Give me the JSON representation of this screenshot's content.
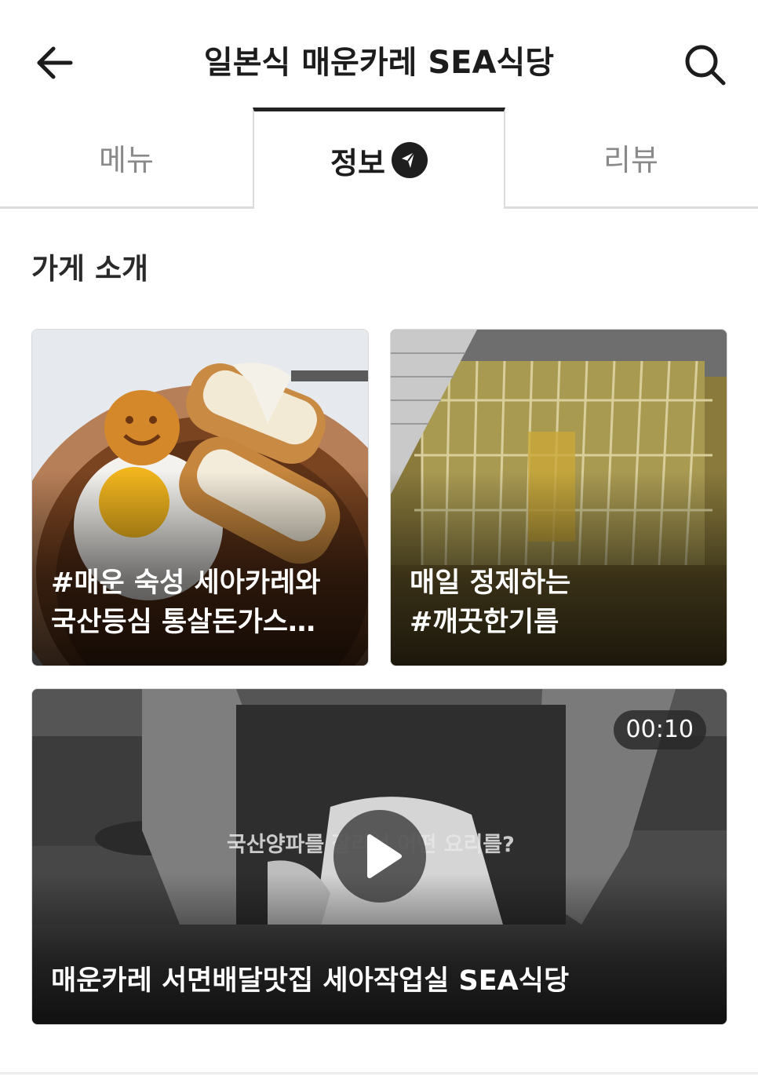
{
  "header": {
    "title": "일본식 매운카레 SEA식당",
    "back_icon": "arrow-left-icon",
    "search_icon": "search-icon"
  },
  "tabs": [
    {
      "label": "메뉴",
      "active": false
    },
    {
      "label": "정보",
      "active": true,
      "badge_icon": "megaphone-icon"
    },
    {
      "label": "리뷰",
      "active": false
    }
  ],
  "section": {
    "title": "가게 소개"
  },
  "cards": [
    {
      "caption_line1": "#매운 숙성 세아카레와",
      "caption_line2": "국산등심 통살돈가스…",
      "image": "curry-bowl-photo"
    },
    {
      "caption_line1": "매일 정제하는",
      "caption_line2": "#깨끗한기름",
      "image": "fryer-oil-photo"
    }
  ],
  "video": {
    "caption": "매운카레 서면배달맛집 세아작업실 SEA식당",
    "duration": "00:10",
    "overlay_text": "국산양파를 잘라서 어떤 요리를?",
    "play_icon": "play-icon",
    "image": "kitchen-video-thumbnail"
  },
  "colors": {
    "active_tab_border": "#222222",
    "inactive_text": "#8a8a8a",
    "divider": "#dcdcdc",
    "text_primary": "#1c1c1c"
  }
}
